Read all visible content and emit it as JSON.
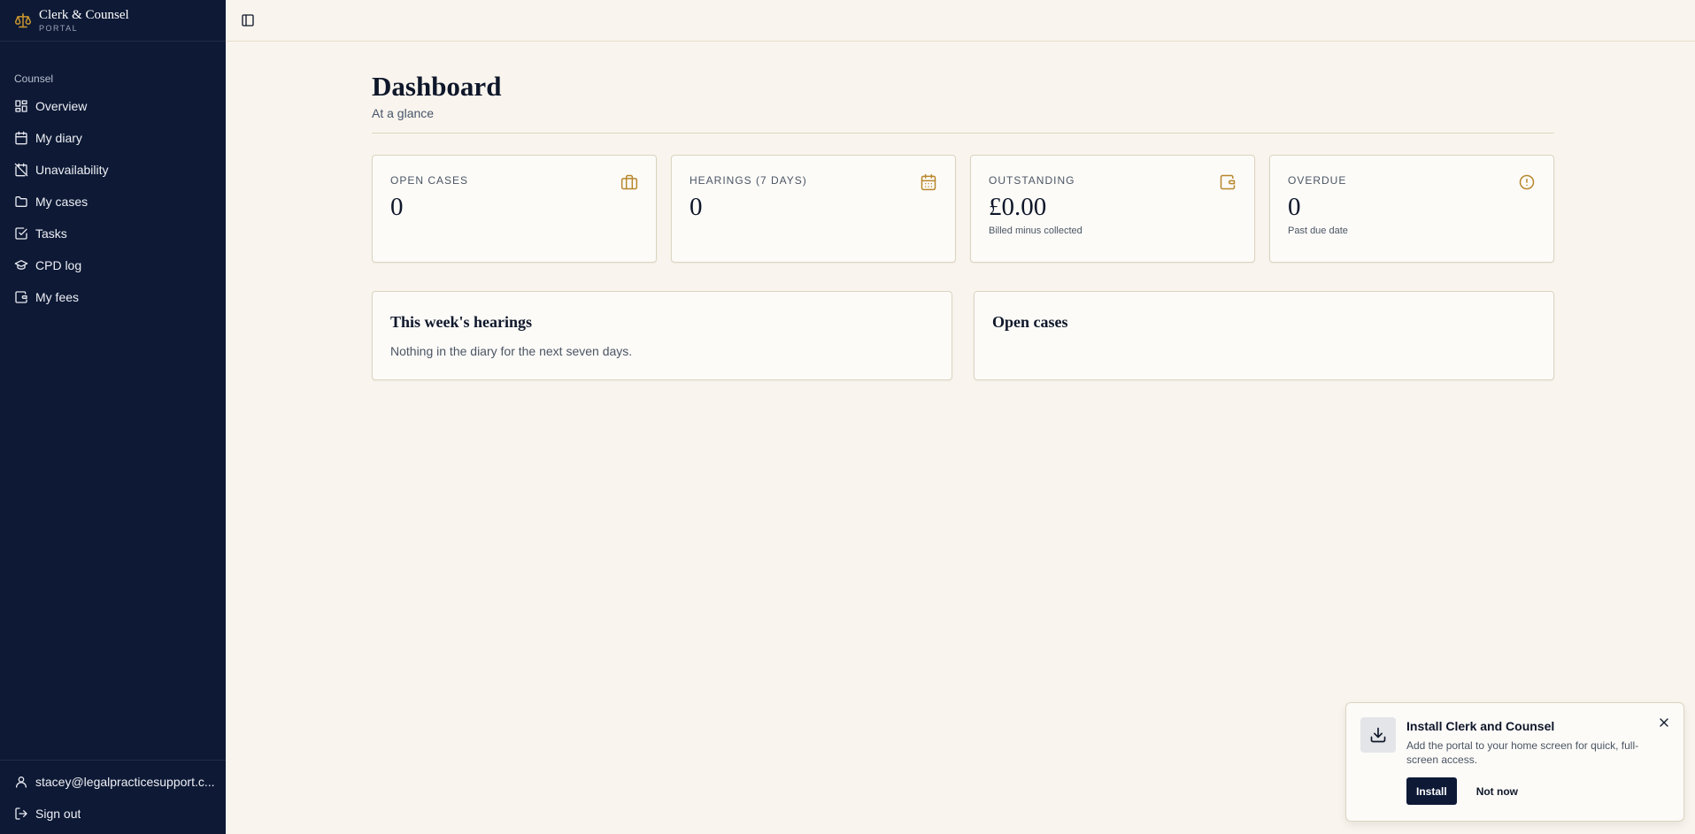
{
  "colors": {
    "sidebar_bg": "#0d1935",
    "page_bg": "#f9f5ee",
    "accent_gold": "#b8872b",
    "primary_button": "#0d1935"
  },
  "brand": {
    "name": "Clerk & Counsel",
    "sub": "PORTAL",
    "icon": "scales-icon"
  },
  "sidebar": {
    "section_label": "Counsel",
    "items": [
      {
        "label": "Overview",
        "icon": "grid-icon"
      },
      {
        "label": "My diary",
        "icon": "calendar-icon"
      },
      {
        "label": "Unavailability",
        "icon": "calendar-off-icon"
      },
      {
        "label": "My cases",
        "icon": "folder-icon"
      },
      {
        "label": "Tasks",
        "icon": "check-square-icon"
      },
      {
        "label": "CPD log",
        "icon": "graduation-cap-icon"
      },
      {
        "label": "My fees",
        "icon": "wallet-icon"
      }
    ],
    "footer": {
      "user_email": "stacey@legalpracticesupport.c...",
      "sign_out": "Sign out"
    }
  },
  "header": {
    "title": "Dashboard",
    "subtitle": "At a glance"
  },
  "stats": [
    {
      "label": "OPEN CASES",
      "value": "0",
      "note": "",
      "icon": "briefcase-icon"
    },
    {
      "label": "HEARINGS (7 DAYS)",
      "value": "0",
      "note": "",
      "icon": "calendar-icon"
    },
    {
      "label": "OUTSTANDING",
      "value": "£0.00",
      "note": "Billed minus collected",
      "icon": "wallet-icon"
    },
    {
      "label": "OVERDUE",
      "value": "0",
      "note": "Past due date",
      "icon": "alert-circle-icon"
    }
  ],
  "panels": {
    "hearings": {
      "title": "This week's hearings",
      "empty": "Nothing in the diary for the next seven days."
    },
    "open_cases": {
      "title": "Open cases"
    }
  },
  "toast": {
    "title": "Install Clerk and Counsel",
    "text": "Add the portal to your home screen for quick, full-screen access.",
    "install": "Install",
    "dismiss": "Not now"
  }
}
